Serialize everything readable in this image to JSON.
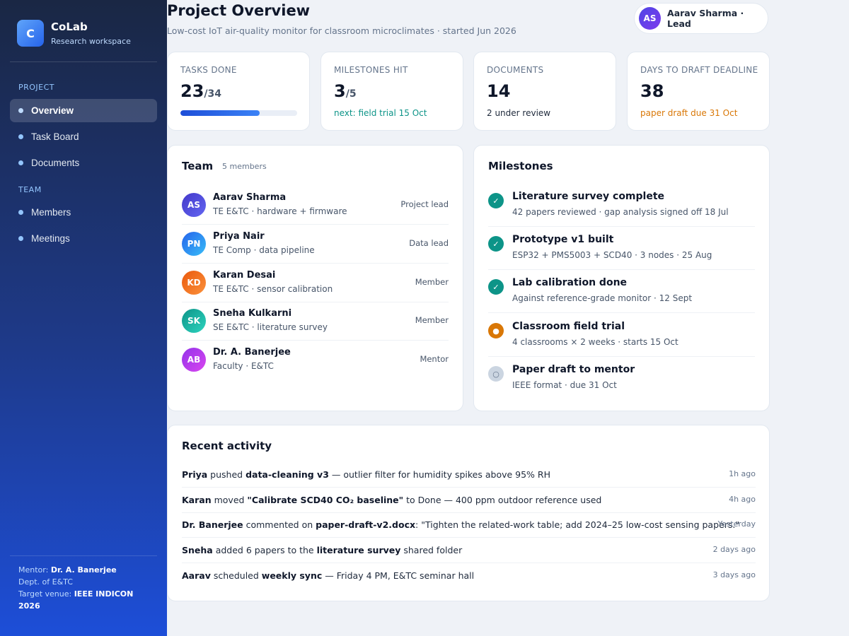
{
  "sidebar": {
    "brand_initial": "C",
    "brand_name": "CoLab",
    "brand_sub": "Research workspace",
    "section_project": "PROJECT",
    "section_team": "TEAM",
    "items": [
      {
        "label": "Overview",
        "active": true
      },
      {
        "label": "Task Board"
      },
      {
        "label": "Documents"
      },
      {
        "label": "Members"
      },
      {
        "label": "Meetings"
      }
    ],
    "footer": {
      "mentor_label": "Mentor: ",
      "mentor_name": "Dr. A. Banerjee",
      "dept": "Dept. of E&TC",
      "venue_label": "Target venue: ",
      "venue_name": "IEEE INDICON 2026"
    }
  },
  "header": {
    "title": "Project Overview",
    "subtitle": "Low-cost IoT air-quality monitor for classroom microclimates · started Jun 2026",
    "user_initials": "AS",
    "user_label": "Aarav Sharma · Lead"
  },
  "stats": {
    "tasks": {
      "label": "TASKS DONE",
      "value": "23",
      "of": "/34",
      "progress": 0.676
    },
    "milestones": {
      "label": "MILESTONES HIT",
      "value": "3",
      "of": "/5",
      "note": "next: field trial 15 Oct"
    },
    "documents": {
      "label": "DOCUMENTS",
      "value": "14",
      "note": "2 under review"
    },
    "deadline": {
      "label": "DAYS TO DRAFT DEADLINE",
      "value": "38",
      "note": "paper draft due 31 Oct"
    }
  },
  "team": {
    "title": "Team",
    "count": "5 members",
    "members": [
      {
        "initials": "AS",
        "name": "Aarav Sharma",
        "desc": "TE E&TC · hardware + firmware",
        "role": "Project lead"
      },
      {
        "initials": "PN",
        "name": "Priya Nair",
        "desc": "TE Comp · data pipeline",
        "role": "Data lead"
      },
      {
        "initials": "KD",
        "name": "Karan Desai",
        "desc": "TE E&TC · sensor calibration",
        "role": "Member"
      },
      {
        "initials": "SK",
        "name": "Sneha Kulkarni",
        "desc": "SE E&TC · literature survey",
        "role": "Member"
      },
      {
        "initials": "AB",
        "name": "Dr. A. Banerjee",
        "desc": "Faculty · E&TC",
        "role": "Mentor"
      }
    ]
  },
  "milestones": {
    "title": "Milestones",
    "items": [
      {
        "icon": "✓",
        "status": "done",
        "title": "Literature survey complete",
        "desc": "42 papers reviewed · gap analysis signed off 18 Jul"
      },
      {
        "icon": "✓",
        "status": "done",
        "title": "Prototype v1 built",
        "desc": "ESP32 + PMS5003 + SCD40 · 3 nodes · 25 Aug"
      },
      {
        "icon": "✓",
        "status": "done",
        "title": "Lab calibration done",
        "desc": "Against reference-grade monitor · 12 Sept"
      },
      {
        "icon": "●",
        "status": "active",
        "title": "Classroom field trial",
        "desc": "4 classrooms × 2 weeks · starts 15 Oct"
      },
      {
        "icon": "○",
        "status": "pending",
        "title": "Paper draft to mentor",
        "desc": "IEEE format · due 31 Oct"
      }
    ]
  },
  "activity": {
    "title": "Recent activity",
    "items": [
      {
        "actor": "Priya",
        "verb": " pushed ",
        "object": "data-cleaning v3",
        "rest": " — outlier filter for humidity spikes above 95% RH",
        "time": "1h ago"
      },
      {
        "actor": "Karan",
        "verb": " moved ",
        "object": "\"Calibrate SCD40 CO₂ baseline\"",
        "rest": " to Done — 400 ppm outdoor reference used",
        "time": "4h ago"
      },
      {
        "actor": "Dr. Banerjee",
        "verb": " commented on ",
        "object": "paper-draft-v2.docx",
        "rest": ": \"Tighten the related-work table; add 2024–25 low-cost sensing papers.\"",
        "time": "Yesterday"
      },
      {
        "actor": "Sneha",
        "verb": " added 6 papers to the ",
        "object": "literature survey",
        "rest": " shared folder",
        "time": "2 days ago"
      },
      {
        "actor": "Aarav",
        "verb": " scheduled ",
        "object": "weekly sync",
        "rest": " — Friday 4 PM, E&TC seminar hall",
        "time": "3 days ago"
      }
    ]
  },
  "colors": {
    "accent": "#1d4ed8",
    "success": "#0d9488",
    "warning": "#d97706",
    "avatar_as": "#4f46e5",
    "avatar_pn": "#3b82f6",
    "avatar_kd": "#f97316",
    "avatar_sk": "#14b8a6",
    "avatar_ab": "#a855f7"
  },
  "icons": {
    "nav_bullet": "dot-icon",
    "milestone_done": "check-icon",
    "milestone_active": "in-progress-icon",
    "milestone_pending": "pending-icon"
  }
}
